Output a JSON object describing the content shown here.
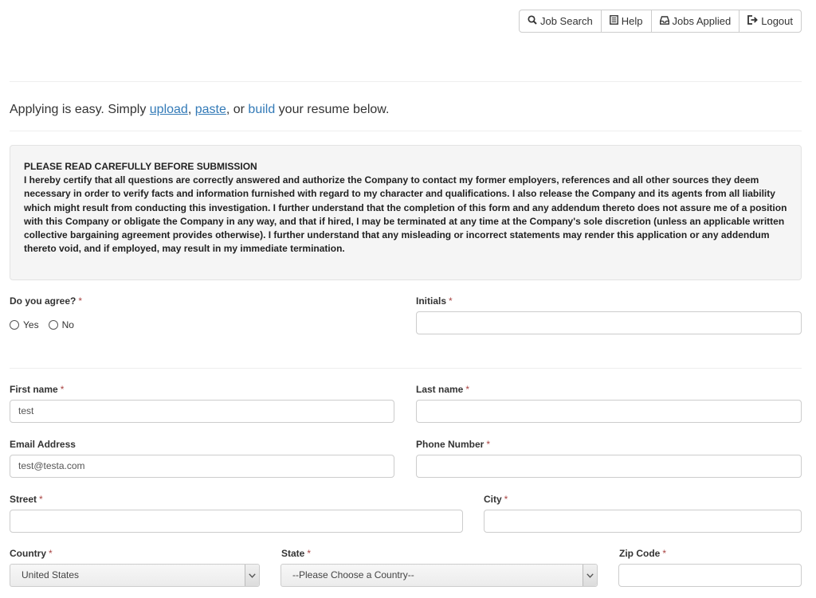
{
  "nav": {
    "job_search": "Job Search",
    "help": "Help",
    "jobs_applied": "Jobs Applied",
    "logout": "Logout"
  },
  "intro": {
    "prefix": "Applying is easy. Simply ",
    "upload": "upload",
    "comma": ", ",
    "paste": "paste",
    "or": ", or ",
    "build": "build",
    "suffix": " your resume below."
  },
  "notice": {
    "heading": "PLEASE READ CAREFULLY BEFORE SUBMISSION",
    "body": "I hereby certify that all questions are correctly answered and authorize the Company to contact my former employers, references and all other sources they deem necessary in order to verify facts and information furnished with regard to my character and qualifications. I also release the Company and its agents from all liability which might result from conducting this investigation. I further understand that the completion of this form and any addendum thereto does not assure me of a position with this Company or obligate the Company in any way, and that if hired, I may be terminated at any time at the Company's sole discretion (unless an applicable written collective bargaining agreement provides otherwise). I further understand that any misleading or incorrect statements may render this application or any addendum thereto void, and if employed, may result in my immediate termination."
  },
  "form": {
    "agree_label": "Do you agree?",
    "yes": "Yes",
    "no": "No",
    "initials_label": "Initials",
    "initials_value": "",
    "first_name_label": "First name",
    "first_name_value": "test",
    "last_name_label": "Last name",
    "last_name_value": "",
    "email_label": "Email Address",
    "email_value": "test@testa.com",
    "phone_label": "Phone Number",
    "phone_value": "",
    "street_label": "Street",
    "street_value": "",
    "city_label": "City",
    "city_value": "",
    "country_label": "Country",
    "country_value": "United States",
    "state_label": "State",
    "state_value": "--Please Choose a Country--",
    "zip_label": "Zip Code",
    "zip_value": "",
    "required_mark": "*"
  },
  "colors": {
    "link": "#337ab7",
    "required": "#a94442",
    "notice_bg": "#f5f5f5"
  },
  "icons": {
    "job_search": "search-icon",
    "help": "document-icon",
    "jobs_applied": "inbox-icon",
    "logout": "logout-icon",
    "select_arrow": "chevron-down-icon"
  }
}
